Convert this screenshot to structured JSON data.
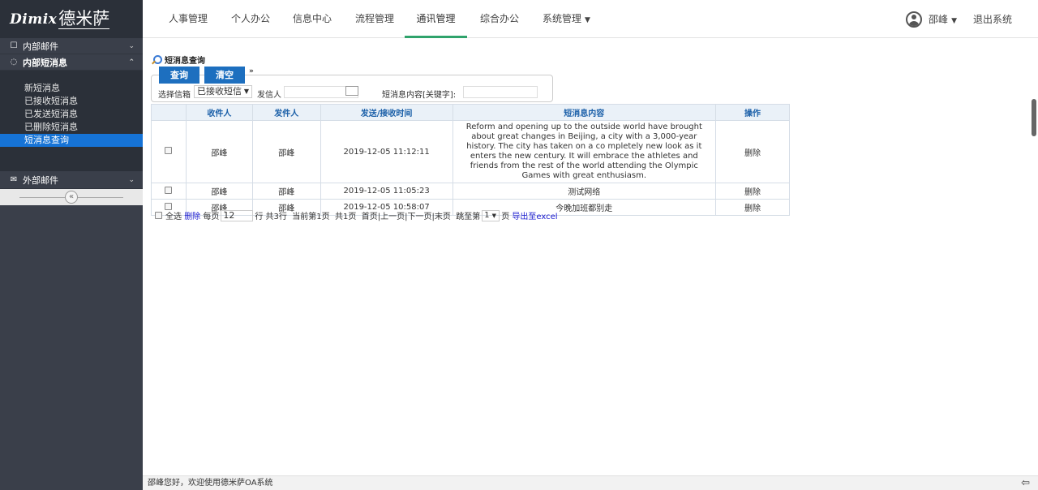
{
  "logo": {
    "brand_en": "Dimix",
    "brand_zh": "德米萨"
  },
  "sidebar": {
    "groups": [
      {
        "label": "内部邮件",
        "icon": "mail-icon",
        "chevron": "»"
      },
      {
        "label": "内部短消息",
        "icon": "chat-icon",
        "chevron": "»"
      },
      {
        "label": "外部邮件",
        "icon": "envelope-icon",
        "chevron": "»"
      }
    ],
    "items": [
      {
        "label": "新短消息"
      },
      {
        "label": "已接收短消息"
      },
      {
        "label": "已发送短消息"
      },
      {
        "label": "已删除短消息"
      },
      {
        "label": "短消息查询"
      }
    ],
    "collapse_label": "«"
  },
  "top_nav": {
    "items": [
      {
        "label": "人事管理"
      },
      {
        "label": "个人办公"
      },
      {
        "label": "信息中心"
      },
      {
        "label": "流程管理"
      },
      {
        "label": "通讯管理"
      },
      {
        "label": "综合办公"
      },
      {
        "label": "系统管理"
      }
    ],
    "active_color": "#2fa36b"
  },
  "user": {
    "name": "邵峰",
    "logout": "退出系统"
  },
  "query": {
    "title": "短消息查询",
    "search_button": "查询",
    "clear_button": "清空",
    "toggle": "»",
    "mailbox_label": "选择信箱",
    "mailbox_value": "已接收短信",
    "sender_label": "发信人",
    "keyword_label": "短消息内容[关键字]:"
  },
  "table": {
    "headers": [
      "",
      "收件人",
      "发件人",
      "发送/接收时间",
      "短消息内容",
      "操作"
    ],
    "rows": [
      {
        "receiver": "邵峰",
        "sender": "邵峰",
        "time": "2019-12-05 11:12:11",
        "content": "Reform and opening up to the outside world have brought about great changes in Beijing, a city with a 3,000-year history. The city has taken on a co mpletely new look as it enters the new century. It will embrace the athletes and friends from the rest of the world attending the Olympic Games with great enthusiasm.",
        "action": "删除"
      },
      {
        "receiver": "邵峰",
        "sender": "邵峰",
        "time": "2019-12-05 11:05:23",
        "content": "测试网络",
        "action": "删除"
      },
      {
        "receiver": "邵峰",
        "sender": "邵峰",
        "time": "2019-12-05 10:58:07",
        "content": "今晚加班都别走",
        "action": "删除"
      }
    ]
  },
  "pager": {
    "select_all": "全选",
    "delete": "删除",
    "per_page_label": "每页",
    "per_page_value": "12",
    "rows_label": "行 共3行",
    "current_page": "当前第1页",
    "total_pages": "共1页",
    "nav": "首页|上一页|下一页|末页",
    "jump_label": "跳至第",
    "jump_value": "1",
    "page_suffix": "页",
    "export": "导出至excel"
  },
  "footer": {
    "welcome": "邵峰您好，欢迎使用德米萨OA系统",
    "toggle": "⇦"
  },
  "colors": {
    "sidebar_bg": "#3a3f4a",
    "active_item": "#1673d6",
    "button_blue": "#1d6fbf",
    "link_blue": "#1a1ad0"
  }
}
